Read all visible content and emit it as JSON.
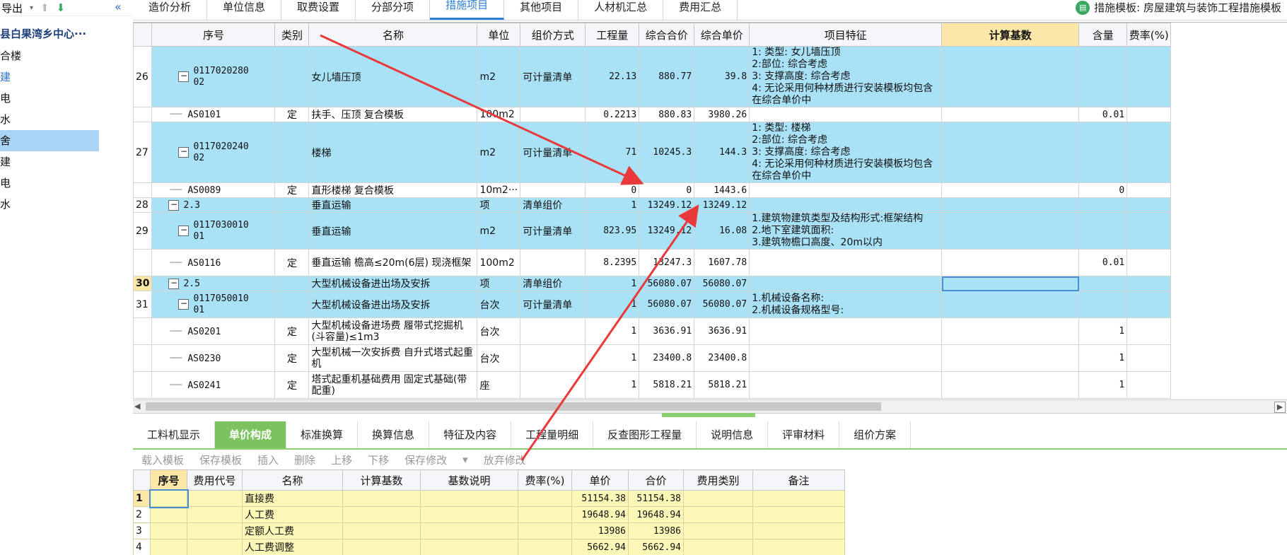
{
  "sidebar": {
    "export_label": "导出",
    "project_title": "县白果湾乡中心···",
    "items": [
      {
        "label": "合楼",
        "state": "normal"
      },
      {
        "label": "建",
        "state": "blue"
      },
      {
        "label": "电",
        "state": "normal"
      },
      {
        "label": "水",
        "state": "normal"
      },
      {
        "label": "舍",
        "state": "selected"
      },
      {
        "label": "建",
        "state": "normal"
      },
      {
        "label": "电",
        "state": "normal"
      },
      {
        "label": "水",
        "state": "normal"
      }
    ]
  },
  "top_tabs": [
    "造价分析",
    "单位信息",
    "取费设置",
    "分部分项",
    "措施项目",
    "其他项目",
    "人材机汇总",
    "费用汇总"
  ],
  "active_top_tab": "措施项目",
  "template_label": "措施模板: 房屋建筑与装饰工程措施模板",
  "grid": {
    "headers": [
      "序号",
      "类别",
      "名称",
      "单位",
      "组价方式",
      "工程量",
      "综合合价",
      "综合单价",
      "项目特征",
      "计算基数",
      "含量",
      "费率(%)"
    ],
    "rows": [
      {
        "rn": "26",
        "code": "011702028002",
        "cat": "",
        "name": "女儿墙压顶",
        "unit": "m2",
        "method": "可计量清单",
        "qty": "22.13",
        "total": "880.77",
        "price": "39.8",
        "feat": "1: 类型: 女儿墙压顶\n2:部位: 综合考虑\n3: 支撑高度: 综合考虑\n4: 无论采用何种材质进行安装模板均包含在综合单价中",
        "base": "",
        "content": "",
        "style": "b"
      },
      {
        "rn": "",
        "code": "AS0101",
        "cat": "定",
        "name": "扶手、压顶 复合模板",
        "unit": "100m2",
        "method": "",
        "qty": "0.2213",
        "total": "880.83",
        "price": "3980.26",
        "feat": "",
        "base": "",
        "content": "0.01",
        "style": "w"
      },
      {
        "rn": "27",
        "code": "011702024002",
        "cat": "",
        "name": "楼梯",
        "unit": "m2",
        "method": "可计量清单",
        "qty": "71",
        "total": "10245.3",
        "price": "144.3",
        "feat": "1: 类型: 楼梯\n2:部位: 综合考虑\n3: 支撑高度: 综合考虑\n4: 无论采用何种材质进行安装模板均包含在综合单价中",
        "base": "",
        "content": "",
        "style": "b"
      },
      {
        "rn": "",
        "code": "AS0089",
        "cat": "定",
        "name": "直形楼梯 复合模板",
        "unit": "10m2···",
        "method": "",
        "qty": "0",
        "total": "0",
        "price": "1443.6",
        "feat": "",
        "base": "",
        "content": "0",
        "style": "w"
      },
      {
        "rn": "28",
        "code": "2.3",
        "cat": "",
        "name": "垂直运输",
        "unit": "项",
        "method": "清单组价",
        "qty": "1",
        "total": "13249.12",
        "price": "13249.12",
        "feat": "",
        "base": "",
        "content": "",
        "style": "b"
      },
      {
        "rn": "29",
        "code": "011703001001",
        "cat": "",
        "name": "垂直运输",
        "unit": "m2",
        "method": "可计量清单",
        "qty": "823.95",
        "total": "13249.12",
        "price": "16.08",
        "feat": "1.建筑物建筑类型及结构形式:框架结构\n2.地下室建筑面积:\n3.建筑物檐口高度、20m以内",
        "base": "",
        "content": "",
        "style": "b"
      },
      {
        "rn": "",
        "code": "AS0116",
        "cat": "定",
        "name": "垂直运输 檐高≤20m(6层) 现浇框架",
        "unit": "100m2",
        "method": "",
        "qty": "8.2395",
        "total": "13247.3",
        "price": "1607.78",
        "feat": "",
        "base": "",
        "content": "0.01",
        "style": "w"
      },
      {
        "rn": "30",
        "code": "2.5",
        "cat": "",
        "name": "大型机械设备进出场及安拆",
        "unit": "项",
        "method": "清单组价",
        "qty": "1",
        "total": "56080.07",
        "price": "56080.07",
        "feat": "",
        "base": "",
        "content": "",
        "style": "b"
      },
      {
        "rn": "31",
        "code": "011705001001",
        "cat": "",
        "name": "大型机械设备进出场及安拆",
        "unit": "台次",
        "method": "可计量清单",
        "qty": "1",
        "total": "56080.07",
        "price": "56080.07",
        "feat": "1.机械设备名称:\n2.机械设备规格型号:",
        "base": "",
        "content": "",
        "style": "b"
      },
      {
        "rn": "",
        "code": "AS0201",
        "cat": "定",
        "name": "大型机械设备进场费 履带式挖掘机(斗容量)≤1m3",
        "unit": "台次",
        "method": "",
        "qty": "1",
        "total": "3636.91",
        "price": "3636.91",
        "feat": "",
        "base": "",
        "content": "1",
        "style": "w"
      },
      {
        "rn": "",
        "code": "AS0230",
        "cat": "定",
        "name": "大型机械一次安拆费 自升式塔式起重机",
        "unit": "台次",
        "method": "",
        "qty": "1",
        "total": "23400.8",
        "price": "23400.8",
        "feat": "",
        "base": "",
        "content": "1",
        "style": "w"
      },
      {
        "rn": "",
        "code": "AS0241",
        "cat": "定",
        "name": "塔式起重机基础费用 固定式基础(带配重)",
        "unit": "座",
        "method": "",
        "qty": "1",
        "total": "5818.21",
        "price": "5818.21",
        "feat": "",
        "base": "",
        "content": "1",
        "style": "w"
      }
    ]
  },
  "bottom_tabs": [
    "工料机显示",
    "单价构成",
    "标准换算",
    "换算信息",
    "特征及内容",
    "工程量明细",
    "反查图形工程量",
    "说明信息",
    "评审材料",
    "组价方案"
  ],
  "active_bottom_tab": "单价构成",
  "toolbar": [
    "载入模板",
    "保存模板",
    "插入",
    "删除",
    "上移",
    "下移",
    "保存修改",
    "放弃修改"
  ],
  "price_grid": {
    "headers": [
      "序号",
      "费用代号",
      "名称",
      "计算基数",
      "基数说明",
      "费率(%)",
      "单价",
      "合价",
      "费用类别",
      "备注"
    ],
    "rows": [
      {
        "rn": "1",
        "name": "直接费",
        "price": "51154.38",
        "total": "51154.38"
      },
      {
        "rn": "2",
        "name": "人工费",
        "price": "19648.94",
        "total": "19648.94"
      },
      {
        "rn": "3",
        "name": "定额人工费",
        "price": "13986",
        "total": "13986"
      },
      {
        "rn": "4",
        "name": "人工费调整",
        "price": "5662.94",
        "total": "5662.94"
      }
    ]
  },
  "colors": {
    "row_blue": "#a9e2f7",
    "accent_blue": "#2a7fd4",
    "accent_green": "#7cc35f",
    "arrow_red": "#e83a3a"
  }
}
